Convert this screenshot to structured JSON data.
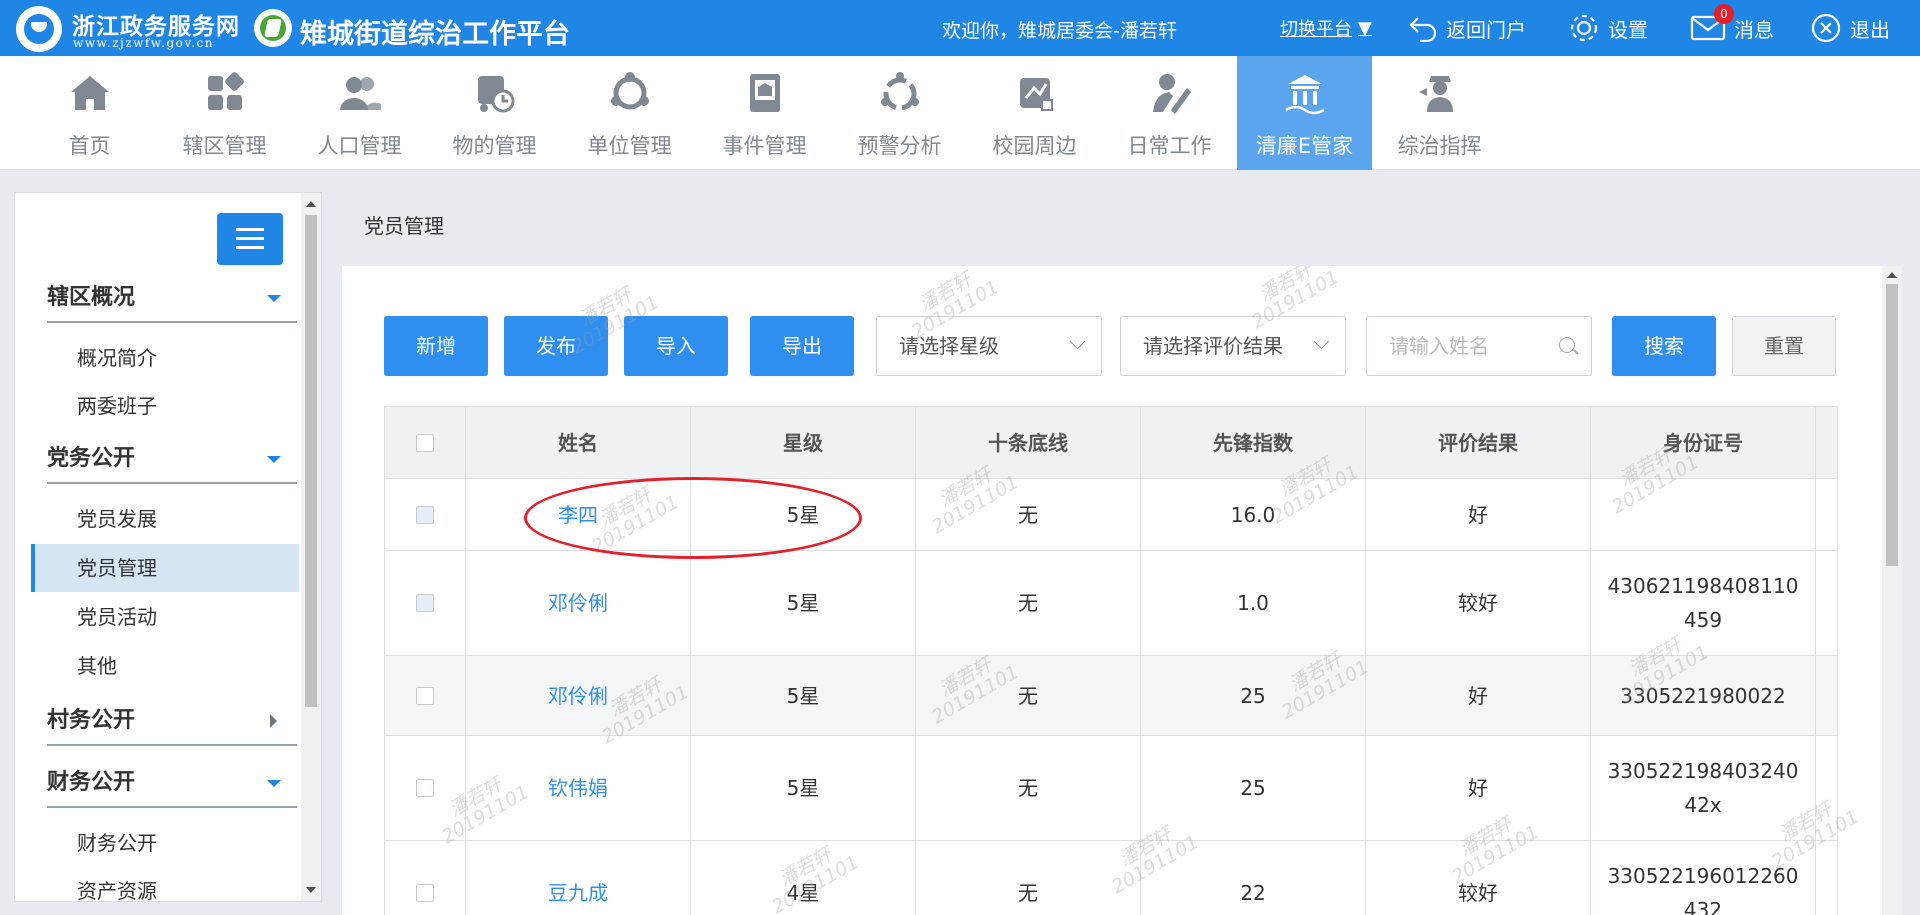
{
  "topbar": {
    "logo_main": "浙江政务服务网",
    "logo_sub": "www.zjzwfw.gov.cn",
    "platform_title": "雉城街道综治工作平台",
    "welcome": "欢迎你，雉城居委会-潘若轩",
    "switch_platform": "切换平台",
    "back_portal": "返回门户",
    "settings": "设置",
    "messages": "消息",
    "message_count": "0",
    "logout": "退出",
    "bar_color": "#1f86e6"
  },
  "nav": {
    "items": [
      {
        "label": "首页",
        "icon": "home-icon"
      },
      {
        "label": "辖区管理",
        "icon": "grid-icon"
      },
      {
        "label": "人口管理",
        "icon": "people-icon"
      },
      {
        "label": "物的管理",
        "icon": "vehicle-icon"
      },
      {
        "label": "单位管理",
        "icon": "org-icon"
      },
      {
        "label": "事件管理",
        "icon": "ledger-icon"
      },
      {
        "label": "预警分析",
        "icon": "alert-icon"
      },
      {
        "label": "校园周边",
        "icon": "school-icon"
      },
      {
        "label": "日常工作",
        "icon": "worker-icon"
      },
      {
        "label": "清廉E管家",
        "icon": "building-icon",
        "active": true
      },
      {
        "label": "综治指挥",
        "icon": "commander-icon"
      }
    ]
  },
  "sidebar": {
    "sections": [
      {
        "title": "辖区概况",
        "expanded": true,
        "items": [
          "概况简介",
          "两委班子"
        ]
      },
      {
        "title": "党务公开",
        "expanded": true,
        "items": [
          "党员发展",
          "党员管理",
          "党员活动",
          "其他"
        ]
      },
      {
        "title": "村务公开",
        "expanded": false,
        "items": []
      },
      {
        "title": "财务公开",
        "expanded": true,
        "items": [
          "财务公开",
          "资产资源"
        ]
      }
    ],
    "active_item": "党员管理"
  },
  "breadcrumb": "党员管理",
  "toolbar": {
    "add": "新增",
    "publish": "发布",
    "import": "导入",
    "export": "导出",
    "star_select_placeholder": "请选择星级",
    "eval_select_placeholder": "请选择评价结果",
    "name_input_placeholder": "请输入姓名",
    "search": "搜索",
    "reset": "重置"
  },
  "table": {
    "columns": [
      "姓名",
      "星级",
      "十条底线",
      "先锋指数",
      "评价结果",
      "身份证号"
    ],
    "rows": [
      {
        "name": "李四",
        "star": "5星",
        "baseline": "无",
        "index": "16.0",
        "eval": "好",
        "id_number": ""
      },
      {
        "name": "邓伶俐",
        "star": "5星",
        "baseline": "无",
        "index": "1.0",
        "eval": "较好",
        "id_number": "430621198408110459"
      },
      {
        "name": "邓伶俐",
        "star": "5星",
        "baseline": "无",
        "index": "25",
        "eval": "好",
        "id_number": "3305221980022"
      },
      {
        "name": "钦伟娟",
        "star": "5星",
        "baseline": "无",
        "index": "25",
        "eval": "好",
        "id_number": "33052219840324042x"
      },
      {
        "name": "豆九成",
        "star": "4星",
        "baseline": "无",
        "index": "22",
        "eval": "较好",
        "id_number": "330522196012260432"
      }
    ]
  },
  "watermark": {
    "name": "潘若轩",
    "date": "20191101"
  },
  "colors": {
    "accent": "#2f8ff0",
    "annotation": "#e5202a",
    "active_nav": "#5ba5ee"
  }
}
